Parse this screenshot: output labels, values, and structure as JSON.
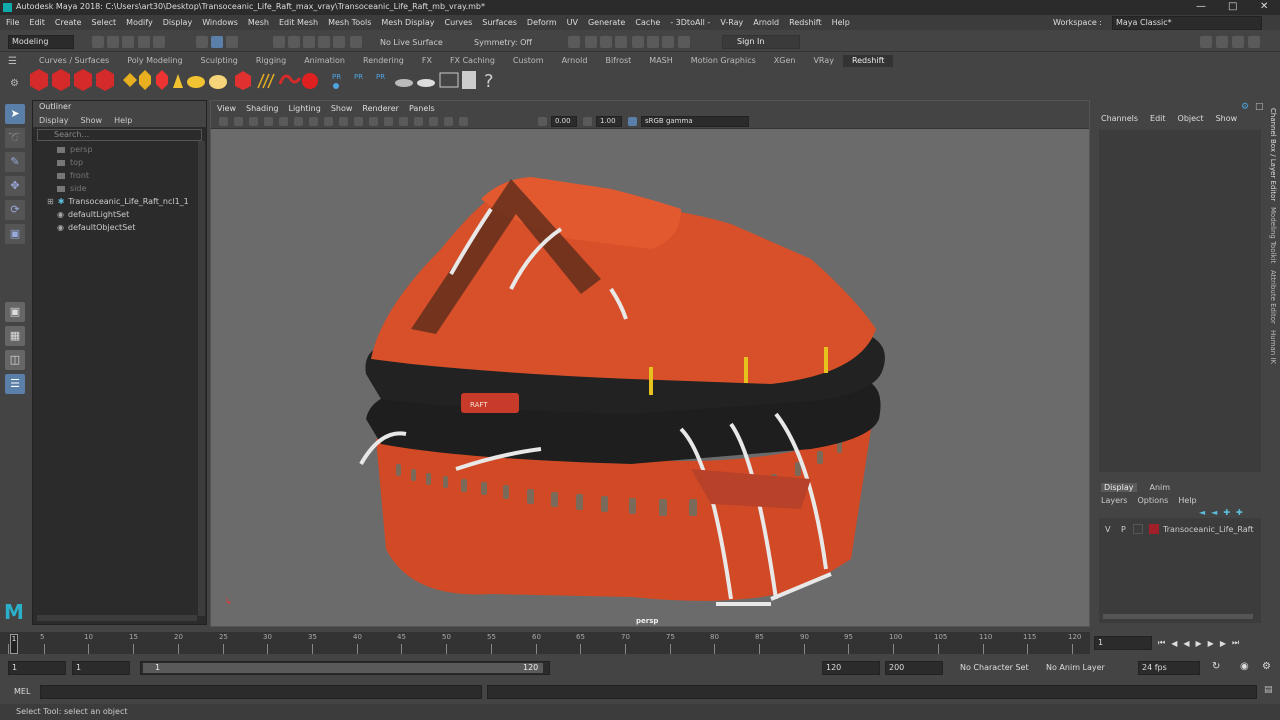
{
  "window": {
    "title": "Autodesk Maya 2018: C:\\Users\\art30\\Desktop\\Transoceanic_Life_Raft_max_vray\\Transoceanic_Life_Raft_mb_vray.mb*",
    "workspace_label": "Workspace :",
    "workspace_value": "Maya Classic*"
  },
  "menubar": [
    "File",
    "Edit",
    "Create",
    "Select",
    "Modify",
    "Display",
    "Windows",
    "Mesh",
    "Edit Mesh",
    "Mesh Tools",
    "Mesh Display",
    "Curves",
    "Surfaces",
    "Deform",
    "UV",
    "Generate",
    "Cache",
    "- 3DtoAll -",
    "V-Ray",
    "Arnold",
    "Redshift",
    "Help"
  ],
  "statusline": {
    "mode": "Modeling",
    "live_surface": "No Live Surface",
    "symmetry": "Symmetry: Off",
    "sign_in": "Sign In"
  },
  "shelf_tabs": [
    "Curves / Surfaces",
    "Poly Modeling",
    "Sculpting",
    "Rigging",
    "Animation",
    "Rendering",
    "FX",
    "FX Caching",
    "Custom",
    "Arnold",
    "Bifrost",
    "MASH",
    "Motion Graphics",
    "XGen",
    "VRay",
    "Redshift"
  ],
  "shelf_active": "Redshift",
  "outliner": {
    "title": "Outliner",
    "menus": [
      "Display",
      "Show",
      "Help"
    ],
    "search_placeholder": "Search...",
    "items": [
      {
        "label": "persp",
        "dim": true,
        "icon": "camera-icon"
      },
      {
        "label": "top",
        "dim": true,
        "icon": "camera-icon"
      },
      {
        "label": "front",
        "dim": true,
        "icon": "camera-icon"
      },
      {
        "label": "side",
        "dim": true,
        "icon": "camera-icon"
      },
      {
        "label": "Transoceanic_Life_Raft_ncl1_1",
        "dim": false,
        "icon": "group-icon"
      },
      {
        "label": "defaultLightSet",
        "dim": false,
        "icon": "set-icon"
      },
      {
        "label": "defaultObjectSet",
        "dim": false,
        "icon": "set-icon"
      }
    ]
  },
  "viewport": {
    "menus": [
      "View",
      "Shading",
      "Lighting",
      "Show",
      "Renderer",
      "Panels"
    ],
    "exposure": "0.00",
    "gamma": "1.00",
    "color_space": "sRGB gamma",
    "camera_label": "persp",
    "badge_text": "RAFT"
  },
  "channel_box": {
    "menus": [
      "Channels",
      "Edit",
      "Object",
      "Show"
    ]
  },
  "layer_editor": {
    "tabs": [
      "Display",
      "Anim"
    ],
    "active_tab": "Display",
    "menus": [
      "Layers",
      "Options",
      "Help"
    ],
    "layer": {
      "v": "V",
      "p": "P",
      "name": "Transoceanic_Life_Raft",
      "color": "#a0202a"
    }
  },
  "side_tabs": [
    "Channel Box / Layer Editor",
    "Modeling Toolkit",
    "Attribute Editor",
    "Human IK"
  ],
  "timeline": {
    "ticks": [
      "1",
      "5",
      "10",
      "15",
      "20",
      "25",
      "30",
      "35",
      "40",
      "45",
      "50",
      "55",
      "60",
      "65",
      "70",
      "75",
      "80",
      "85",
      "90",
      "95",
      "100",
      "105",
      "110",
      "115",
      "120"
    ],
    "current_frame": "1"
  },
  "range": {
    "start": "1",
    "inner_start": "1",
    "slider_start": "1",
    "slider_end": "120",
    "end": "120",
    "outer_end": "200",
    "character_set": "No Character Set",
    "anim_layer": "No Anim Layer",
    "fps": "24 fps"
  },
  "mel_label": "MEL",
  "help_line": "Select Tool: select an object"
}
